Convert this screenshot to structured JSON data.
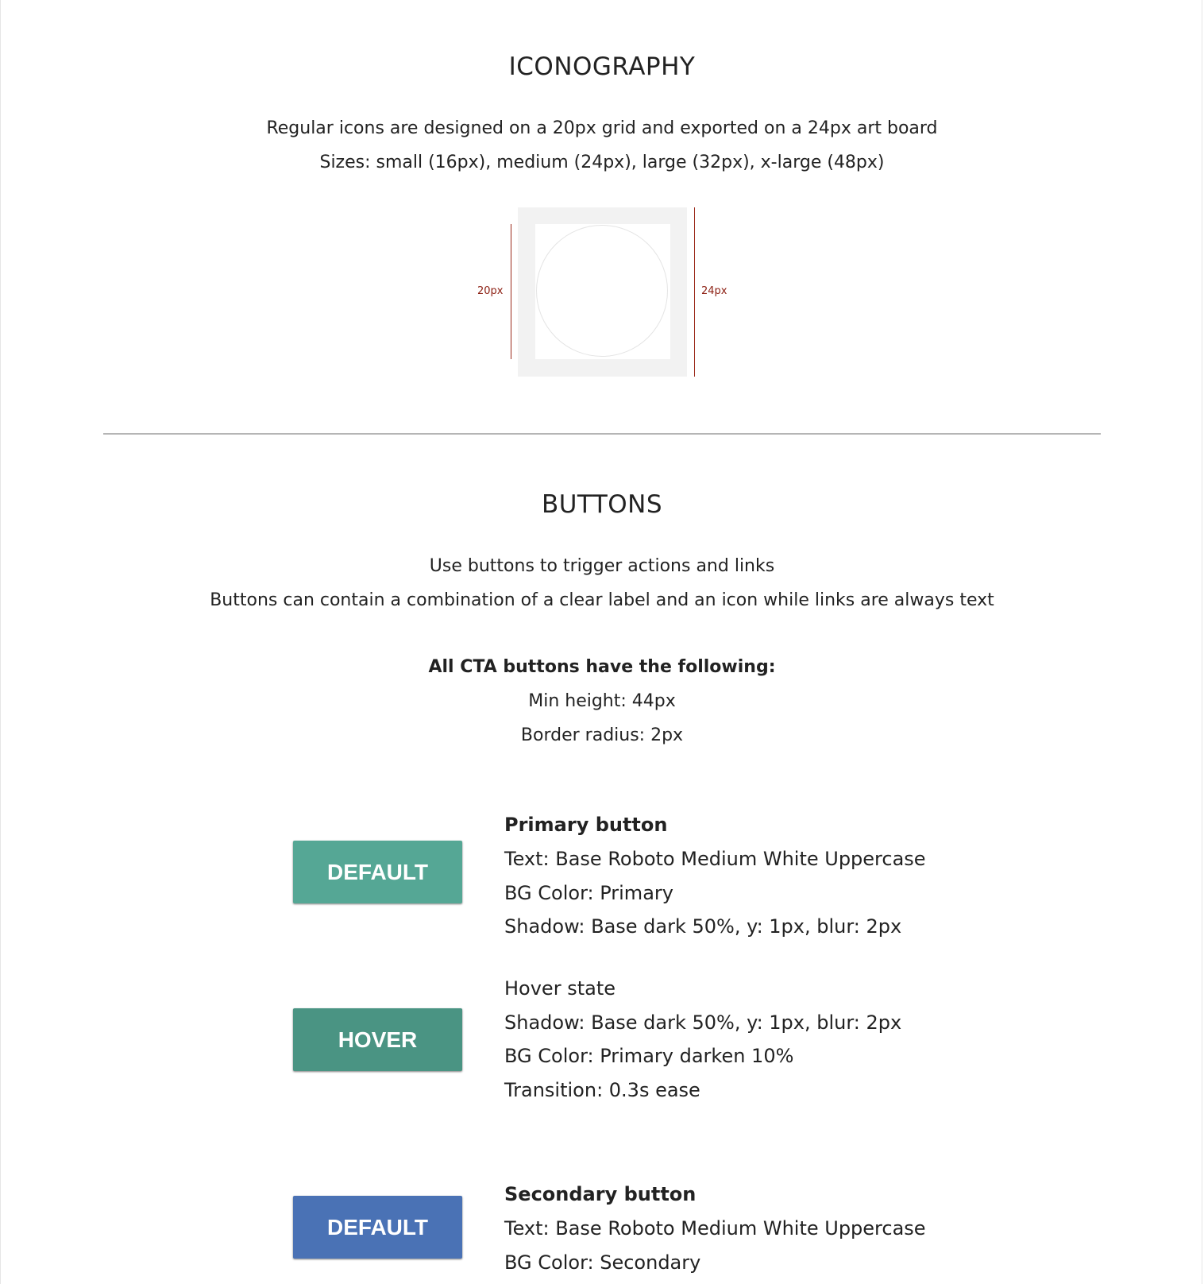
{
  "iconography": {
    "title": "ICONOGRAPHY",
    "lines": [
      "Regular icons are designed on a 20px grid and exported on a 24px art board",
      "Sizes: small (16px), medium (24px), large (32px), x-large (48px)"
    ],
    "figure": {
      "grid_label": "20px",
      "artboard_label": "24px",
      "measure_color": "#9b2a1a"
    }
  },
  "buttons_section": {
    "title": "BUTTONS",
    "lines": [
      "Use buttons to trigger actions and links",
      "Buttons can contain a combination of a clear label and an icon while links are always text"
    ],
    "cta_heading": "All CTA buttons have the following:",
    "cta_specs": [
      "Min height: 44px",
      "Border radius: 2px"
    ]
  },
  "primary": {
    "default_button": {
      "label": "DEFAULT",
      "color": "#55a795"
    },
    "hover_button": {
      "label": "HOVER",
      "color": "#4a9483"
    },
    "specs": [
      "Primary button",
      "Text: Base Roboto Medium White Uppercase",
      "BG Color: Primary",
      "Shadow: Base dark 50%, y: 1px, blur: 2px"
    ],
    "hover_specs": [
      "Hover state",
      "Shadow: Base dark 50%, y: 1px, blur: 2px",
      "BG Color: Primary darken 10%",
      "Transition: 0.3s ease"
    ]
  },
  "secondary": {
    "default_button": {
      "label": "DEFAULT",
      "color": "#4a72b5"
    },
    "specs": [
      "Secondary button",
      "Text: Base Roboto Medium White Uppercase",
      "BG Color: Secondary"
    ]
  }
}
